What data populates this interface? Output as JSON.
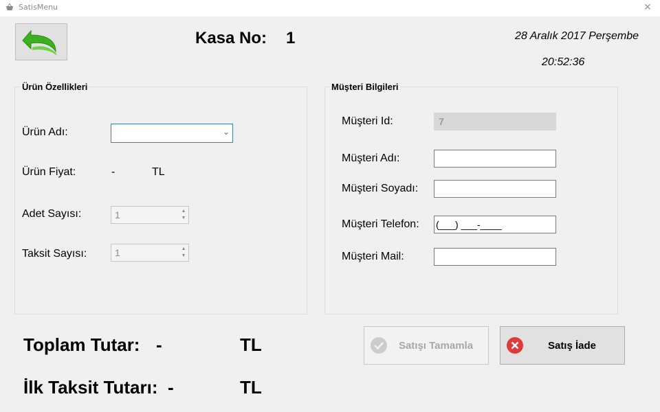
{
  "window": {
    "title": "SatisMenu",
    "close_glyph": "✕"
  },
  "header": {
    "kasa_label": "Kasa No:",
    "kasa_value": "1",
    "date": "28 Aralık 2017 Perşembe",
    "time": "20:52:36"
  },
  "urun": {
    "group_title": "Ürün Özellikleri",
    "name_label": "Ürün Adı:",
    "name_value": "",
    "price_label": "Ürün Fiyat:",
    "price_value": "-",
    "price_unit": "TL",
    "adet_label": "Adet Sayısı:",
    "adet_value": "1",
    "taksit_label": "Taksit Sayısı:",
    "taksit_value": "1"
  },
  "musteri": {
    "group_title": "Müşteri Bilgileri",
    "id_label": "Müşteri Id:",
    "id_value": "7",
    "adi_label": "Müşteri Adı:",
    "adi_value": "",
    "soyadi_label": "Müşteri Soyadı:",
    "soyadi_value": "",
    "telefon_label": "Müşteri Telefon:",
    "telefon_value": "(___) ___-____",
    "mail_label": "Müşteri Mail:",
    "mail_value": ""
  },
  "totals": {
    "toplam_label": "Toplam Tutar:",
    "toplam_value": "-",
    "toplam_unit": "TL",
    "ilk_taksit_label": "İlk Taksit Tutarı:",
    "ilk_taksit_value": "-",
    "ilk_taksit_unit": "TL"
  },
  "buttons": {
    "complete_label": "Satışı Tamamla",
    "iade_label": "Satış İade"
  },
  "icons": {
    "back": "back-arrow-icon",
    "complete": "check-circle-icon",
    "iade": "x-circle-icon",
    "app": "basket-icon"
  },
  "colors": {
    "back_arrow": "#3cb01e",
    "complete_icon": "#c8c8c8",
    "iade_icon": "#e03a3a",
    "combo_border": "#3c7fb1"
  }
}
